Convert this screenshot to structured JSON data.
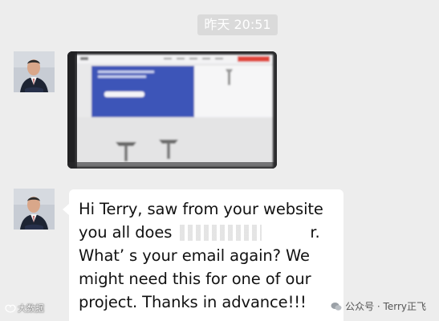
{
  "chat": {
    "timestamp": "昨天 20:51",
    "messages": [
      {
        "type": "image",
        "sender_avatar": "business-man-avatar"
      },
      {
        "type": "text",
        "sender_avatar": "business-man-avatar",
        "lines": [
          "Hi Terry, saw from your website",
          "you all does",
          "What’ s your email again? We",
          "might need this for one of our",
          "project. Thanks in advance!!!"
        ],
        "line2_tail": "r."
      }
    ]
  },
  "watermarks": {
    "left": "大数据",
    "right": "公众号 · Terry正飞"
  },
  "colors": {
    "background": "#ededed",
    "bubble": "#ffffff",
    "timestamp_bg": "#dadada",
    "site_header_red": "#e0443a",
    "site_hero_blue": "#3d55b8"
  }
}
